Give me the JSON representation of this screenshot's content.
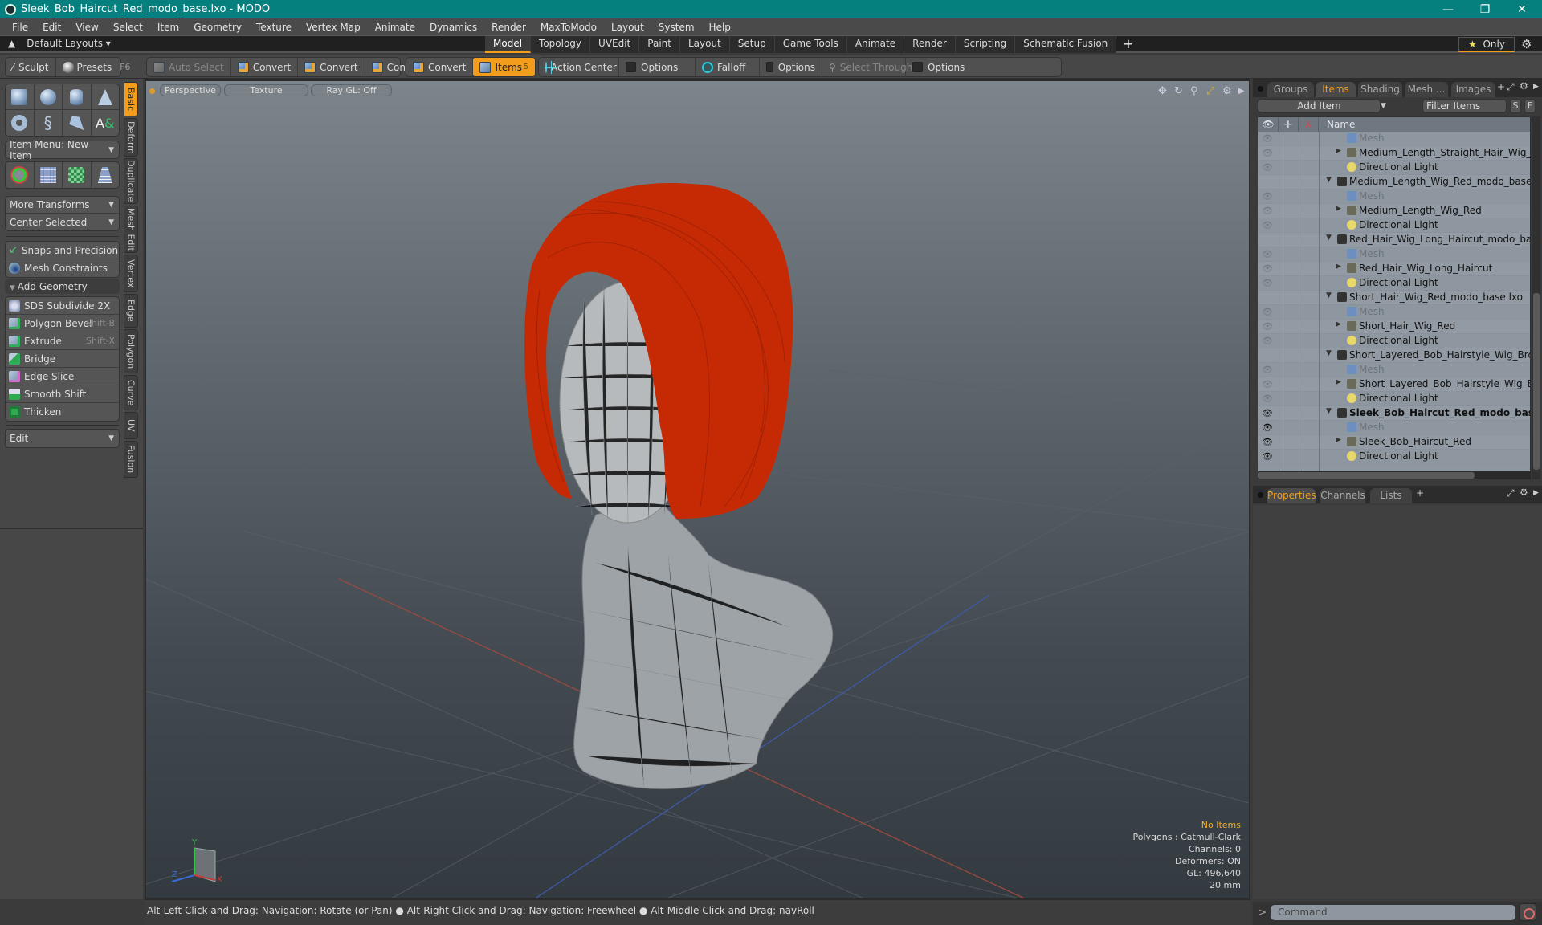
{
  "window": {
    "title": "Sleek_Bob_Haircut_Red_modo_base.lxo - MODO",
    "controls": [
      "minimize",
      "restore",
      "close"
    ]
  },
  "menu": [
    "File",
    "Edit",
    "View",
    "Select",
    "Item",
    "Geometry",
    "Texture",
    "Vertex Map",
    "Animate",
    "Dynamics",
    "Render",
    "MaxToModo",
    "Layout",
    "System",
    "Help"
  ],
  "layoutbar": {
    "layouts_label": "Default Layouts ▾",
    "tabs": [
      "Model",
      "Topology",
      "UVEdit",
      "Paint",
      "Layout",
      "Setup",
      "Game Tools",
      "Animate",
      "Render",
      "Scripting",
      "Schematic Fusion"
    ],
    "active_tab": "Model",
    "only_label": "Only"
  },
  "toolbar": {
    "sculpt": "Sculpt",
    "presets": "Presets",
    "presets_shortcut": "F6",
    "auto_select": "Auto Select",
    "convert1": "Convert",
    "convert2": "Convert",
    "convert3": "Convert",
    "convert4": "Convert",
    "items": "Items",
    "items_shortcut": "5",
    "action_center": "Action Center",
    "options1": "Options",
    "falloff": "Falloff",
    "options2": "Options",
    "select_through": "Select Through",
    "options3": "Options"
  },
  "left_panel": {
    "vertical_tabs": [
      "Basic",
      "Deform",
      "Duplicate",
      "Mesh Edit",
      "Vertex",
      "Edge",
      "Polygon",
      "Curve",
      "UV",
      "Fusion"
    ],
    "active_vtab": "Basic",
    "item_menu": "Item Menu: New Item",
    "more_transforms": "More Transforms",
    "center_selected": "Center Selected",
    "snaps": "Snaps and Precision",
    "mesh_constraints": "Mesh Constraints",
    "add_geometry": "Add Geometry",
    "tools": [
      {
        "label": "SDS Subdivide 2X",
        "shortcut": ""
      },
      {
        "label": "Polygon Bevel",
        "shortcut": "Shift-B"
      },
      {
        "label": "Extrude",
        "shortcut": "Shift-X"
      },
      {
        "label": "Bridge",
        "shortcut": ""
      },
      {
        "label": "Edge Slice",
        "shortcut": ""
      },
      {
        "label": "Smooth Shift",
        "shortcut": ""
      },
      {
        "label": "Thicken",
        "shortcut": ""
      }
    ],
    "edit_dropdown": "Edit"
  },
  "viewport": {
    "view_mode": "Perspective",
    "shading": "Texture",
    "raygl": "Ray GL: Off",
    "hud": {
      "selection": "No Items",
      "polygons": "Polygons : Catmull-Clark",
      "channels": "Channels: 0",
      "deformers": "Deformers: ON",
      "gl": "GL: 496,640",
      "scale": "20 mm"
    },
    "axis_labels": {
      "x": "X",
      "y": "Y",
      "z": "Z"
    }
  },
  "right_panel": {
    "tabs": [
      "Groups",
      "Items",
      "Shading",
      "Mesh ...",
      "Images"
    ],
    "active_tab": "Items",
    "add_item": "Add Item",
    "filter_placeholder": "Filter Items",
    "s_btn": "S",
    "f_btn": "F",
    "name_header": "Name",
    "tree": [
      {
        "label": "Mesh",
        "type": "mesh",
        "depth": 2,
        "eye": "dim"
      },
      {
        "label": "Medium_Length_Straight_Hair_Wig_Dark",
        "type": "group",
        "depth": 2,
        "eye": "dim"
      },
      {
        "label": "Directional Light",
        "type": "light",
        "depth": 2,
        "eye": "dim"
      },
      {
        "label": "Medium_Length_Wig_Red_modo_base.lxo",
        "type": "scene",
        "depth": 1,
        "eye": "none"
      },
      {
        "label": "Mesh",
        "type": "mesh",
        "depth": 2,
        "eye": "dim"
      },
      {
        "label": "Medium_Length_Wig_Red",
        "type": "group",
        "depth": 2,
        "eye": "dim"
      },
      {
        "label": "Directional Light",
        "type": "light",
        "depth": 2,
        "eye": "dim"
      },
      {
        "label": "Red_Hair_Wig_Long_Haircut_modo_base.lxo",
        "type": "scene",
        "depth": 1,
        "eye": "none"
      },
      {
        "label": "Mesh",
        "type": "mesh",
        "depth": 2,
        "eye": "dim"
      },
      {
        "label": "Red_Hair_Wig_Long_Haircut",
        "type": "group",
        "depth": 2,
        "eye": "dim"
      },
      {
        "label": "Directional Light",
        "type": "light",
        "depth": 2,
        "eye": "dim"
      },
      {
        "label": "Short_Hair_Wig_Red_modo_base.lxo",
        "type": "scene",
        "depth": 1,
        "eye": "none"
      },
      {
        "label": "Mesh",
        "type": "mesh",
        "depth": 2,
        "eye": "dim"
      },
      {
        "label": "Short_Hair_Wig_Red",
        "type": "group",
        "depth": 2,
        "eye": "dim"
      },
      {
        "label": "Directional Light",
        "type": "light",
        "depth": 2,
        "eye": "dim"
      },
      {
        "label": "Short_Layered_Bob_Hairstyle_Wig_Brown ...",
        "type": "scene",
        "depth": 1,
        "eye": "none"
      },
      {
        "label": "Mesh",
        "type": "mesh",
        "depth": 2,
        "eye": "dim"
      },
      {
        "label": "Short_Layered_Bob_Hairstyle_Wig_Brown",
        "type": "group",
        "depth": 2,
        "eye": "dim"
      },
      {
        "label": "Directional Light",
        "type": "light",
        "depth": 2,
        "eye": "dim"
      },
      {
        "label": "Sleek_Bob_Haircut_Red_modo_bas ...",
        "type": "scene",
        "depth": 1,
        "eye": "on",
        "bold": true
      },
      {
        "label": "Mesh",
        "type": "mesh",
        "depth": 2,
        "eye": "on"
      },
      {
        "label": "Sleek_Bob_Haircut_Red",
        "type": "group",
        "depth": 2,
        "eye": "on"
      },
      {
        "label": "Directional Light",
        "type": "light",
        "depth": 2,
        "eye": "on"
      }
    ],
    "lower_tabs": [
      "Properties",
      "Channels",
      "Lists"
    ],
    "lower_active": "Properties",
    "command_placeholder": "Command"
  },
  "statusbar": {
    "hint1": "Alt-Left Click and Drag: Navigation: Rotate (or Pan)",
    "hint2": "Alt-Right Click and Drag: Navigation: Freewheel",
    "hint3": "Alt-Middle Click and Drag: navRoll"
  },
  "colors": {
    "accent": "#f29d1c",
    "titlebar": "#05807f",
    "hair": "#c62a05"
  }
}
